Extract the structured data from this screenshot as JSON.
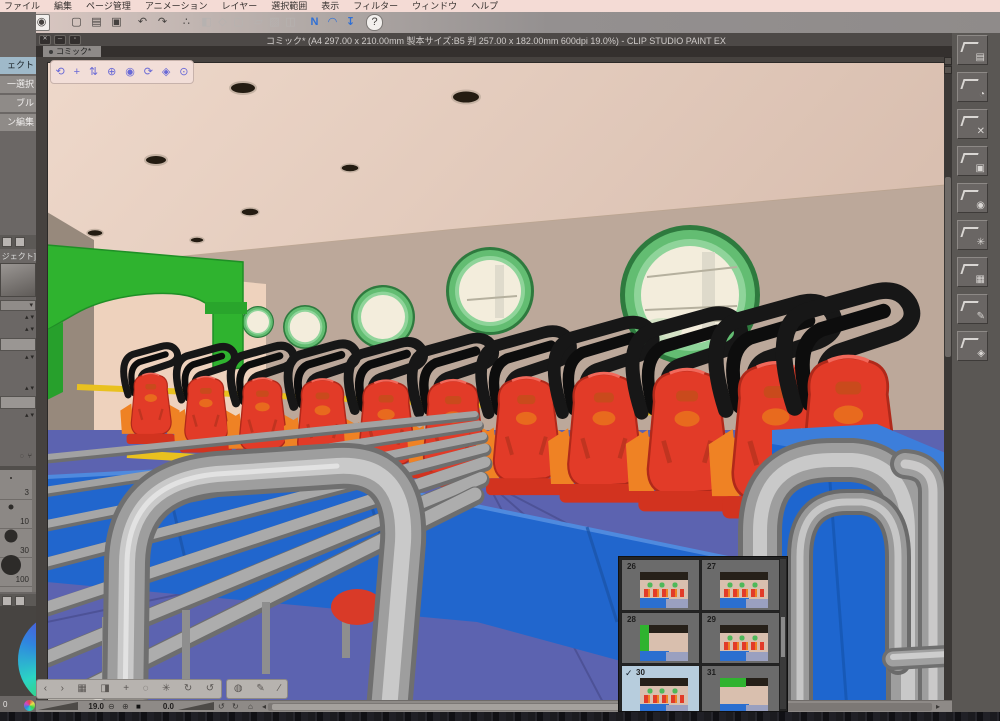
{
  "window": {
    "title_bar": "コミック* (A4 297.00 x 210.00mm 製本サイズ:B5 判 257.00 x 182.00mm 600dpi 19.0%)  - CLIP STUDIO PAINT EX",
    "controls": {
      "close": "✕",
      "minimize": "─",
      "restore": "▫"
    }
  },
  "menu_bar": {
    "items": [
      "ファイル",
      "編集",
      "ページ管理",
      "アニメーション",
      "レイヤー",
      "選択範囲",
      "表示",
      "フィルター",
      "ウィンドウ",
      "ヘルプ"
    ]
  },
  "command_bar": {
    "icons": [
      {
        "name": "clip-studio",
        "glyph": "◉"
      },
      {
        "name": "new-document",
        "glyph": "▢"
      },
      {
        "name": "open-file",
        "glyph": "▤"
      },
      {
        "name": "save",
        "glyph": "▣"
      },
      {
        "name": "undo",
        "glyph": "↶"
      },
      {
        "name": "redo",
        "glyph": "↷"
      },
      {
        "name": "clear",
        "glyph": "∴"
      },
      {
        "name": "fill",
        "glyph": "◧"
      },
      {
        "name": "scale-rotate",
        "glyph": "◇"
      },
      {
        "name": "frame",
        "glyph": "▢"
      },
      {
        "name": "flip-horizontal",
        "glyph": "▱"
      },
      {
        "name": "flip-vertical",
        "glyph": "▨"
      },
      {
        "name": "crop",
        "glyph": "◫"
      },
      {
        "name": "snap-to-ruler",
        "glyph": "N"
      },
      {
        "name": "snap-to-special-ruler",
        "glyph": "◠"
      },
      {
        "name": "snap-to-grid",
        "glyph": "↧"
      },
      {
        "name": "help",
        "glyph": "?"
      }
    ]
  },
  "tab": {
    "label": "コミック*"
  },
  "left_panel": {
    "subtools": [
      {
        "label": "ェクト"
      },
      {
        "label": "一選択"
      },
      {
        "label": "ブル"
      },
      {
        "label": "ン編集"
      }
    ],
    "object_caption": "ジェクト]",
    "brush_sizes": [
      "3",
      "10",
      "30",
      "100"
    ],
    "footer_value": "0"
  },
  "viewer_3d_toolbar": {
    "icons": [
      {
        "name": "camera-rotate",
        "glyph": "⟲"
      },
      {
        "name": "camera-pan",
        "glyph": "+"
      },
      {
        "name": "camera-dolly",
        "glyph": "⇅"
      },
      {
        "name": "object-move",
        "glyph": "⊕"
      },
      {
        "name": "object-rotate",
        "glyph": "◉"
      },
      {
        "name": "object-spin",
        "glyph": "⟳"
      },
      {
        "name": "object-scale",
        "glyph": "◈"
      },
      {
        "name": "camera-reset",
        "glyph": "⊙"
      }
    ]
  },
  "bottom_toolbar": {
    "group1": [
      {
        "name": "prev-camera-angle",
        "glyph": "‹"
      },
      {
        "name": "next-camera-angle",
        "glyph": "›"
      },
      {
        "name": "camera-angle-grid",
        "glyph": "▦"
      },
      {
        "name": "render-settings",
        "glyph": "◨"
      },
      {
        "name": "move-object",
        "glyph": "+"
      },
      {
        "name": "roll-object",
        "glyph": "◌"
      },
      {
        "name": "light-source",
        "glyph": "✳"
      },
      {
        "name": "rotate-cw",
        "glyph": "↻"
      },
      {
        "name": "rotate-ccw",
        "glyph": "↺"
      }
    ],
    "group2": [
      {
        "name": "material-sphere",
        "glyph": "◍"
      },
      {
        "name": "pen-touch",
        "glyph": "✎"
      },
      {
        "name": "dropper",
        "glyph": "∕"
      }
    ]
  },
  "status_bar": {
    "zoom_value": "19.0",
    "rotation_value": "0.0",
    "zoom_out": "⊖",
    "zoom_in": "⊕",
    "fit": "■",
    "rotate_left": "↺",
    "rotate_right": "↻",
    "reset": "⌂",
    "collapse": "◂"
  },
  "page_manager": {
    "check": "✓",
    "pages": [
      {
        "num": "26"
      },
      {
        "num": "27"
      },
      {
        "num": "28"
      },
      {
        "num": "29"
      },
      {
        "num": "30",
        "selected": true
      },
      {
        "num": "31"
      }
    ]
  },
  "material_strip": {
    "buttons": [
      {
        "name": "material-all",
        "glyph": "▤"
      },
      {
        "name": "material-color-pattern",
        "glyph": "◔"
      },
      {
        "name": "material-monochrome",
        "glyph": "✕"
      },
      {
        "name": "material-3d",
        "glyph": "▣"
      },
      {
        "name": "material-pose",
        "glyph": "◉"
      },
      {
        "name": "material-effect",
        "glyph": "✳"
      },
      {
        "name": "material-image",
        "glyph": "▦"
      },
      {
        "name": "material-pen",
        "glyph": "✎"
      },
      {
        "name": "material-body-type",
        "glyph": "◈"
      }
    ]
  },
  "scene_colors": {
    "ceiling": "#e2c9ba",
    "wall": "#bca89a",
    "far_wall": "#eed2bd",
    "arch_green": "#2fb32f",
    "window_ring": "#63bd72",
    "window_glass": "#f3eddc",
    "seat_red": "#e23b28",
    "seat_orange": "#ef8224",
    "harness_black": "#171717",
    "rail_yellow": "#e9c11f",
    "train_blue": "#2166cd",
    "floor_purple": "#5c63b0",
    "pipe_gray": "#9e9e9e"
  }
}
